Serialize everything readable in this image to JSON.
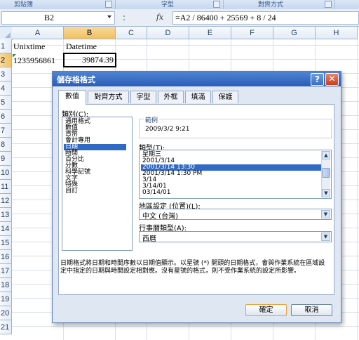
{
  "ribbon": {
    "group_1": "剪貼簿",
    "group_2": "字型",
    "group_3": "對齊方式"
  },
  "formula_bar": {
    "name_box": "B2",
    "fx_label": "fx",
    "formula": "=A2 / 86400 + 25569 + 8 / 24"
  },
  "sheet": {
    "columns": [
      "A",
      "B",
      "C",
      "D",
      "E",
      "F",
      "G",
      "H"
    ],
    "rows": [
      "1",
      "2",
      "3",
      "4",
      "5",
      "6",
      "7",
      "8",
      "9",
      "10",
      "11",
      "12",
      "13",
      "14",
      "15",
      "16",
      "17",
      "18",
      "19",
      "20",
      "21"
    ],
    "cells": {
      "A1": "Unixtime",
      "B1": "Datetime",
      "A2": "1235956861",
      "B2": "39874.39"
    }
  },
  "dialog": {
    "title": "儲存格格式",
    "help": "?",
    "close": "✕",
    "tabs": [
      "數值",
      "對齊方式",
      "字型",
      "外框",
      "填滿",
      "保護"
    ],
    "category_label": "類別(C):",
    "categories": [
      "通用格式",
      "數值",
      "貨幣",
      "會計專用",
      "日期",
      "時間",
      "百分比",
      "分數",
      "科學記號",
      "文字",
      "特殊",
      "自訂"
    ],
    "selected_category": "日期",
    "sample_label": "範例",
    "sample_value": "2009/3/2 9:21",
    "type_label": "類型(T):",
    "types": [
      "星期三",
      "2001/3/14",
      "2001/3/14 13:30",
      "2001/3/14 1:30 PM",
      "3/14",
      "3/14/01",
      "03/14/01"
    ],
    "selected_type": "2001/3/14 13:30",
    "locale_label": "地區設定 (位置)(L):",
    "locale_value": "中文 (台灣)",
    "calendar_label": "行事曆類型(A):",
    "calendar_value": "西曆",
    "description": "日期格式將日期和時間序數以日期值顯示。以星號 (*) 開頭的日期格式，會與作業系統在區域設定中指定的日期與時間設定相對應。沒有星號的格式，則不受作業系統的設定所影響。",
    "ok": "確定",
    "cancel": "取消"
  },
  "colors": {
    "selection": "#316ac5",
    "title_bar": "#2a5db8",
    "header_selected": "#f1c15f"
  }
}
